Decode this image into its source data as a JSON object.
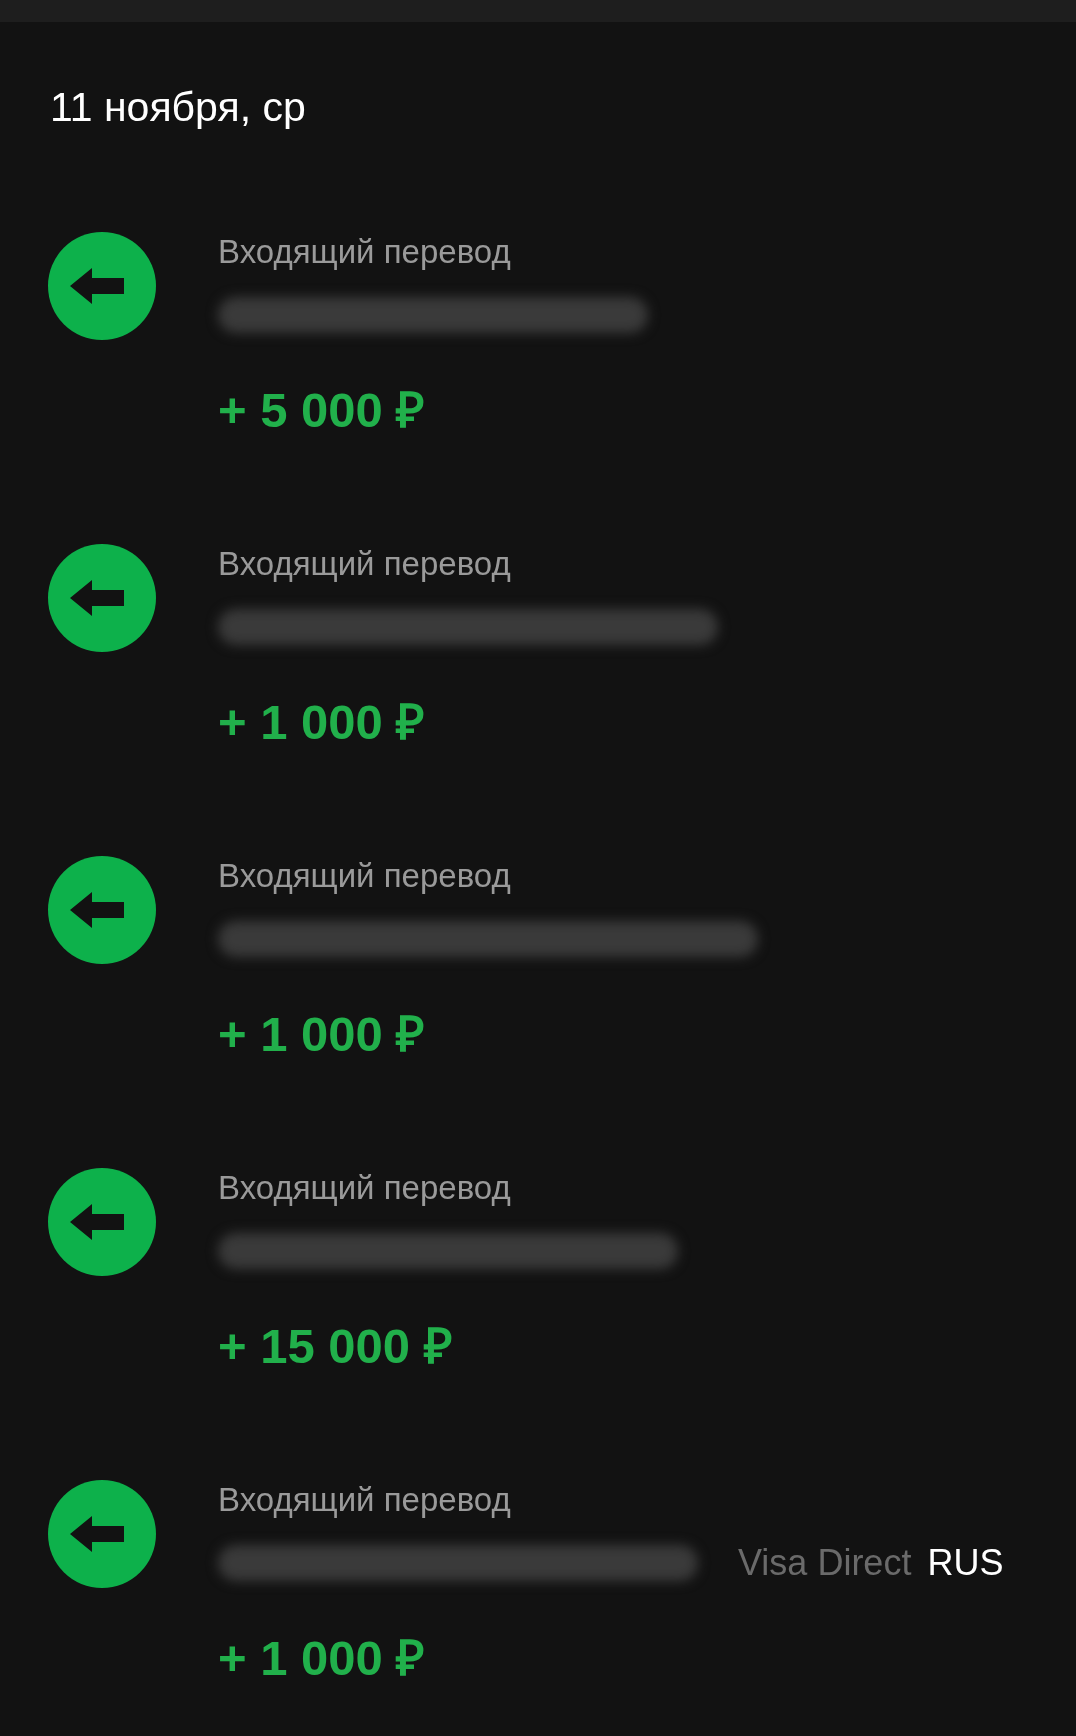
{
  "date_header": "11 ноября, ср",
  "transactions": [
    {
      "label": "Входящий перевод",
      "name_redacted": true,
      "amount": "+ 5 000 ₽"
    },
    {
      "label": "Входящий перевод",
      "name_redacted": true,
      "amount": "+ 1 000 ₽"
    },
    {
      "label": "Входящий перевод",
      "name_redacted": true,
      "amount": "+ 1 000 ₽"
    },
    {
      "label": "Входящий перевод",
      "name_redacted": true,
      "amount": "+ 15 000 ₽"
    },
    {
      "label": "Входящий перевод",
      "name_redacted": true,
      "details": [
        {
          "text": "Visa Direct",
          "kind": "faded"
        },
        {
          "text": "RUS",
          "kind": "plain"
        }
      ],
      "amount": "+ 1 000 ₽"
    }
  ]
}
